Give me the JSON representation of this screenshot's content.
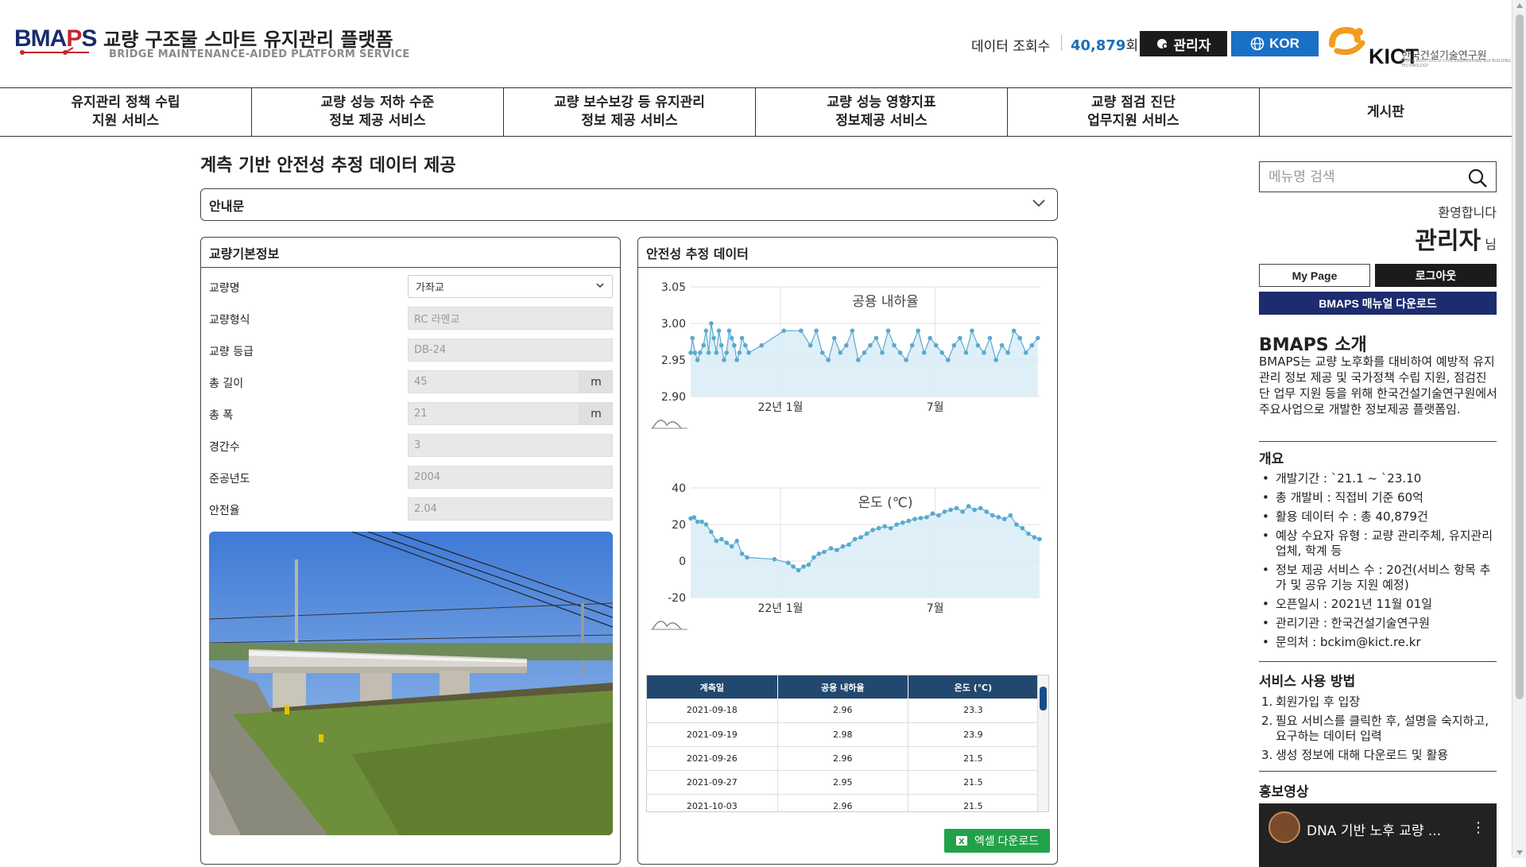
{
  "header": {
    "logo_text_a": "BMA",
    "logo_text_b": "P",
    "logo_text_c": "S",
    "site_title": "교량 구조물 스마트 유지관리 플랫폼",
    "site_subtitle": "BRIDGE MAINTENANCE-AIDED PLATFORM SERVICE",
    "view_label": "데이터 조회수",
    "view_count": "40,879",
    "view_unit": "회",
    "admin_label": "관리자",
    "lang_label": "KOR",
    "kict_text": "KICT",
    "kict_name": "한국건설기술연구원",
    "kict_sub": "KOREA INSTITUTE of CIVIL ENGINEERING and BUILDING TECHNOLOGY"
  },
  "nav": [
    {
      "line1": "유지관리 정책 수립",
      "line2": "지원 서비스"
    },
    {
      "line1": "교량 성능 저하 수준",
      "line2": "정보 제공 서비스"
    },
    {
      "line1": "교량 보수보강 등 유지관리",
      "line2": "정보 제공 서비스"
    },
    {
      "line1": "교량 성능 영향지표",
      "line2": "정보제공 서비스"
    },
    {
      "line1": "교량 점검 진단",
      "line2": "업무지원 서비스"
    },
    {
      "line1": "게시판",
      "line2": ""
    }
  ],
  "page": {
    "title": "계측 기반 안전성 추정 데이터 제공",
    "guide_label": "안내문"
  },
  "info_panel": {
    "title": "교량기본정보",
    "fields": [
      {
        "label": "교량명",
        "value": "가좌교",
        "kind": "select"
      },
      {
        "label": "교량형식",
        "value": "RC 라멘교"
      },
      {
        "label": "교량 등급",
        "value": "DB-24"
      },
      {
        "label": "총 길이",
        "value": "45",
        "unit": "m"
      },
      {
        "label": "총 폭",
        "value": "21",
        "unit": "m"
      },
      {
        "label": "경간수",
        "value": "3"
      },
      {
        "label": "준공년도",
        "value": "2004"
      },
      {
        "label": "안전율",
        "value": "2.04"
      }
    ]
  },
  "data_panel": {
    "title": "안전성 추정 데이터",
    "excel_label": "엑셀 다운로드",
    "table": {
      "headers": [
        "계측일",
        "공용 내하율",
        "온도 (℃)"
      ],
      "rows": [
        [
          "2021-09-18",
          "2.96",
          "23.3"
        ],
        [
          "2021-09-19",
          "2.98",
          "23.9"
        ],
        [
          "2021-09-26",
          "2.96",
          "21.5"
        ],
        [
          "2021-09-27",
          "2.95",
          "21.5"
        ],
        [
          "2021-10-03",
          "2.96",
          "21.5"
        ]
      ]
    }
  },
  "chart_data": [
    {
      "type": "area",
      "title": "공용 내하율",
      "ylim": [
        2.9,
        3.05
      ],
      "yticks": [
        "3.05",
        "3.00",
        "2.95",
        "2.90"
      ],
      "xticks": [
        "22년 1월",
        "7월"
      ],
      "x_range": [
        "2021-09-18",
        "2022-11-01"
      ],
      "color": "#5aa9cf",
      "x": [
        "2021-09-18",
        "2021-09-20",
        "2021-09-23",
        "2021-09-26",
        "2021-09-29",
        "2021-10-03",
        "2021-10-06",
        "2021-10-09",
        "2021-10-12",
        "2021-10-15",
        "2021-10-18",
        "2021-10-21",
        "2021-10-24",
        "2021-10-27",
        "2021-10-30",
        "2021-11-02",
        "2021-11-05",
        "2021-11-08",
        "2021-11-11",
        "2021-11-14",
        "2021-11-17",
        "2021-11-21",
        "2021-11-25",
        "2021-12-10",
        "2022-01-05",
        "2022-01-25",
        "2022-02-05",
        "2022-02-12",
        "2022-02-19",
        "2022-02-26",
        "2022-03-05",
        "2022-03-12",
        "2022-03-19",
        "2022-03-26",
        "2022-04-02",
        "2022-04-09",
        "2022-04-16",
        "2022-04-23",
        "2022-04-30",
        "2022-05-07",
        "2022-05-14",
        "2022-05-21",
        "2022-05-28",
        "2022-06-04",
        "2022-06-11",
        "2022-06-18",
        "2022-06-25",
        "2022-07-02",
        "2022-07-09",
        "2022-07-16",
        "2022-07-23",
        "2022-07-30",
        "2022-08-06",
        "2022-08-13",
        "2022-08-20",
        "2022-08-27",
        "2022-09-03",
        "2022-09-10",
        "2022-09-17",
        "2022-09-24",
        "2022-10-01",
        "2022-10-08",
        "2022-10-15",
        "2022-10-22",
        "2022-10-29"
      ],
      "values": [
        2.96,
        2.98,
        2.96,
        2.95,
        2.96,
        2.97,
        2.99,
        2.96,
        3.0,
        2.98,
        2.96,
        2.99,
        2.97,
        2.95,
        2.96,
        2.99,
        2.98,
        2.97,
        2.95,
        2.96,
        2.98,
        2.97,
        2.96,
        2.97,
        2.99,
        2.99,
        2.97,
        2.99,
        2.96,
        2.95,
        2.98,
        2.96,
        2.97,
        2.99,
        2.95,
        2.96,
        2.97,
        2.98,
        2.96,
        2.99,
        2.97,
        2.96,
        2.95,
        2.97,
        2.99,
        2.96,
        2.98,
        2.97,
        2.96,
        2.95,
        2.97,
        2.98,
        2.96,
        2.99,
        2.97,
        2.96,
        2.98,
        2.95,
        2.97,
        2.96,
        2.99,
        2.98,
        2.96,
        2.97,
        2.98
      ]
    },
    {
      "type": "area",
      "title": "온도 (℃)",
      "ylim": [
        -20,
        40
      ],
      "yticks": [
        "40",
        "20",
        "0",
        "-20"
      ],
      "xticks": [
        "22년 1월",
        "7월"
      ],
      "x_range": [
        "2021-09-18",
        "2022-11-01"
      ],
      "color": "#5aa9cf",
      "x": [
        "2021-09-18",
        "2021-09-22",
        "2021-09-26",
        "2021-10-01",
        "2021-10-06",
        "2021-10-12",
        "2021-10-18",
        "2021-10-24",
        "2021-10-30",
        "2021-11-05",
        "2021-11-11",
        "2021-11-17",
        "2021-11-23",
        "2021-12-25",
        "2022-01-10",
        "2022-01-16",
        "2022-01-22",
        "2022-01-28",
        "2022-02-03",
        "2022-02-09",
        "2022-02-15",
        "2022-02-21",
        "2022-03-01",
        "2022-03-08",
        "2022-03-15",
        "2022-03-22",
        "2022-03-29",
        "2022-04-05",
        "2022-04-12",
        "2022-04-19",
        "2022-04-26",
        "2022-05-03",
        "2022-05-10",
        "2022-05-17",
        "2022-05-24",
        "2022-05-31",
        "2022-06-07",
        "2022-06-14",
        "2022-06-21",
        "2022-06-28",
        "2022-07-05",
        "2022-07-12",
        "2022-07-19",
        "2022-07-26",
        "2022-08-02",
        "2022-08-09",
        "2022-08-16",
        "2022-08-23",
        "2022-08-30",
        "2022-09-06",
        "2022-09-13",
        "2022-09-20",
        "2022-09-27",
        "2022-10-04",
        "2022-10-11",
        "2022-10-18",
        "2022-10-25",
        "2022-10-31"
      ],
      "values": [
        23.3,
        23.9,
        21.5,
        21.5,
        20.0,
        16.0,
        11.0,
        12.0,
        10.0,
        8.0,
        11.0,
        4.0,
        2.0,
        1.0,
        -1.0,
        -3.0,
        -5.0,
        -3.0,
        -2.0,
        2.0,
        4.0,
        5.0,
        7.0,
        6.0,
        8.0,
        9.0,
        12.0,
        13.0,
        15.0,
        17.0,
        18.0,
        19.0,
        18.0,
        20.0,
        21.0,
        22.0,
        23.0,
        23.5,
        24.0,
        26.0,
        25.0,
        27.0,
        28.0,
        29.0,
        27.0,
        30.0,
        28.0,
        29.0,
        27.0,
        25.0,
        24.0,
        23.0,
        25.0,
        20.0,
        18.0,
        15.0,
        13.0,
        12.0
      ]
    }
  ],
  "sidebar": {
    "search_placeholder": "메뉴명 검색",
    "welcome": "환영합니다",
    "username": "관리자",
    "username_suffix": "님",
    "mypage_label": "My Page",
    "logout_label": "로그아웃",
    "manual_label": "BMAPS 매뉴얼 다운로드",
    "intro_title": "BMAPS 소개",
    "intro_text": "BMAPS는 교량 노후화를 대비하여 예방적 유지관리 정보 제공 및 국가정책 수립 지원, 점검진단 업무 지원 등을 위해 한국건설기술연구원에서 주요사업으로 개발한 정보제공 플랫폼임.",
    "overview_title": "개요",
    "overview": [
      "개발기간 : `21.1 ~ `23.10",
      "총 개발비 : 직접비 기준 60억",
      "활용 데이터 수 : 총 40,879건",
      "예상 수요자 유형 : 교량 관리주체, 유지관리 업체, 학계 등",
      "정보 제공 서비스 수 : 20건(서비스 항목 추가 및 공유 기능 지원 예정)",
      "오픈일시 : 2021년 11월 01일",
      "관리기관 : 한국건설기술연구원",
      "문의처 : bckim@kict.re.kr"
    ],
    "usage_title": "서비스 사용 방법",
    "usage": [
      "회원가입 후 입장",
      "필요 서비스를 클릭한 후, 설명을 숙지하고, 요구하는 데이터 입력",
      "생성 정보에 대해 다운로드 및 활용"
    ],
    "video_title": "홍보영상",
    "video_caption": "DNA 기반 노후 교량 ..."
  }
}
